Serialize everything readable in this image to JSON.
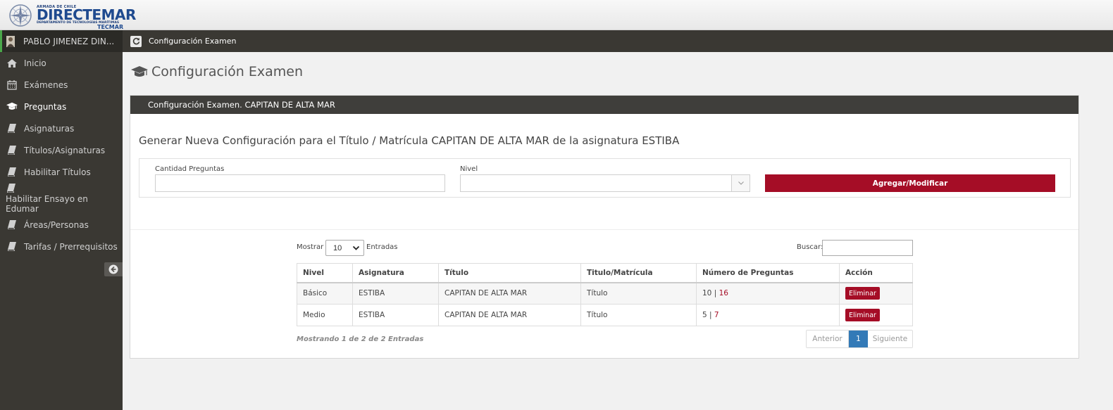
{
  "header": {
    "brand": "DIRECTEMAR",
    "brand_top": "ARMADA DE CHILE",
    "brand_small": "DEPARTAMENTO DE TECNOLOGÍAS MARÍTIMAS",
    "brand_sub": "TECMAR"
  },
  "sidebar": {
    "user": "PABLO JIMENEZ DIN...",
    "items": [
      {
        "label": "Inicio",
        "icon": "home-icon"
      },
      {
        "label": "Exámenes",
        "icon": "calendar-icon"
      },
      {
        "label": "Preguntas",
        "icon": "graduation-cap-icon"
      },
      {
        "label": "Asignaturas",
        "icon": "book-icon"
      },
      {
        "label": "Títulos/Asignaturas",
        "icon": "book-icon"
      },
      {
        "label": "Habilitar Títulos",
        "icon": "book-icon"
      },
      {
        "label": "Habilitar Ensayo en Edumar",
        "icon": "book-icon"
      },
      {
        "label": "Áreas/Personas",
        "icon": "book-icon"
      },
      {
        "label": "Tarifas / Prerrequisitos",
        "icon": "book-icon"
      }
    ],
    "active": "Preguntas"
  },
  "breadcrumb": {
    "label": "Configuración Examen"
  },
  "page": {
    "title": "Configuración Examen"
  },
  "panel": {
    "heading": "Configuración Examen. CAPITAN DE ALTA MAR",
    "generate_title": "Generar Nueva Configuración para el Título / Matrícula CAPITAN DE ALTA MAR de la asignatura ESTIBA",
    "form": {
      "cantidad_label": "Cantidad Preguntas",
      "cantidad_value": "",
      "nivel_label": "Nivel",
      "nivel_value": "",
      "submit_label": "Agregar/Modificar"
    }
  },
  "table": {
    "show_label": "Mostrar",
    "page_length": "10",
    "entries_label": "Entradas",
    "search_label": "Buscar:",
    "search_value": "",
    "columns": [
      "Nivel",
      "Asignatura",
      "Título",
      "Titulo/Matrícula",
      "Número de Preguntas",
      "Acción"
    ],
    "rows": [
      {
        "nivel": "Básico",
        "asignatura": "ESTIBA",
        "titulo": "CAPITAN DE ALTA MAR",
        "tipo": "Título",
        "num_a": "10",
        "sep": "|",
        "num_b": "16",
        "action": "Eliminar"
      },
      {
        "nivel": "Medio",
        "asignatura": "ESTIBA",
        "titulo": "CAPITAN DE ALTA MAR",
        "tipo": "Título",
        "num_a": "5",
        "sep": "|",
        "num_b": "7",
        "action": "Eliminar"
      }
    ],
    "info": "Mostrando 1 de 2 de 2 Entradas",
    "pagination": {
      "prev": "Anterior",
      "current": "1",
      "next": "Siguiente"
    }
  },
  "colors": {
    "sidebar_bg": "#3a3833",
    "accent_red": "#a50d26",
    "page_active": "#337ab7",
    "online_green": "#4aa84a"
  }
}
